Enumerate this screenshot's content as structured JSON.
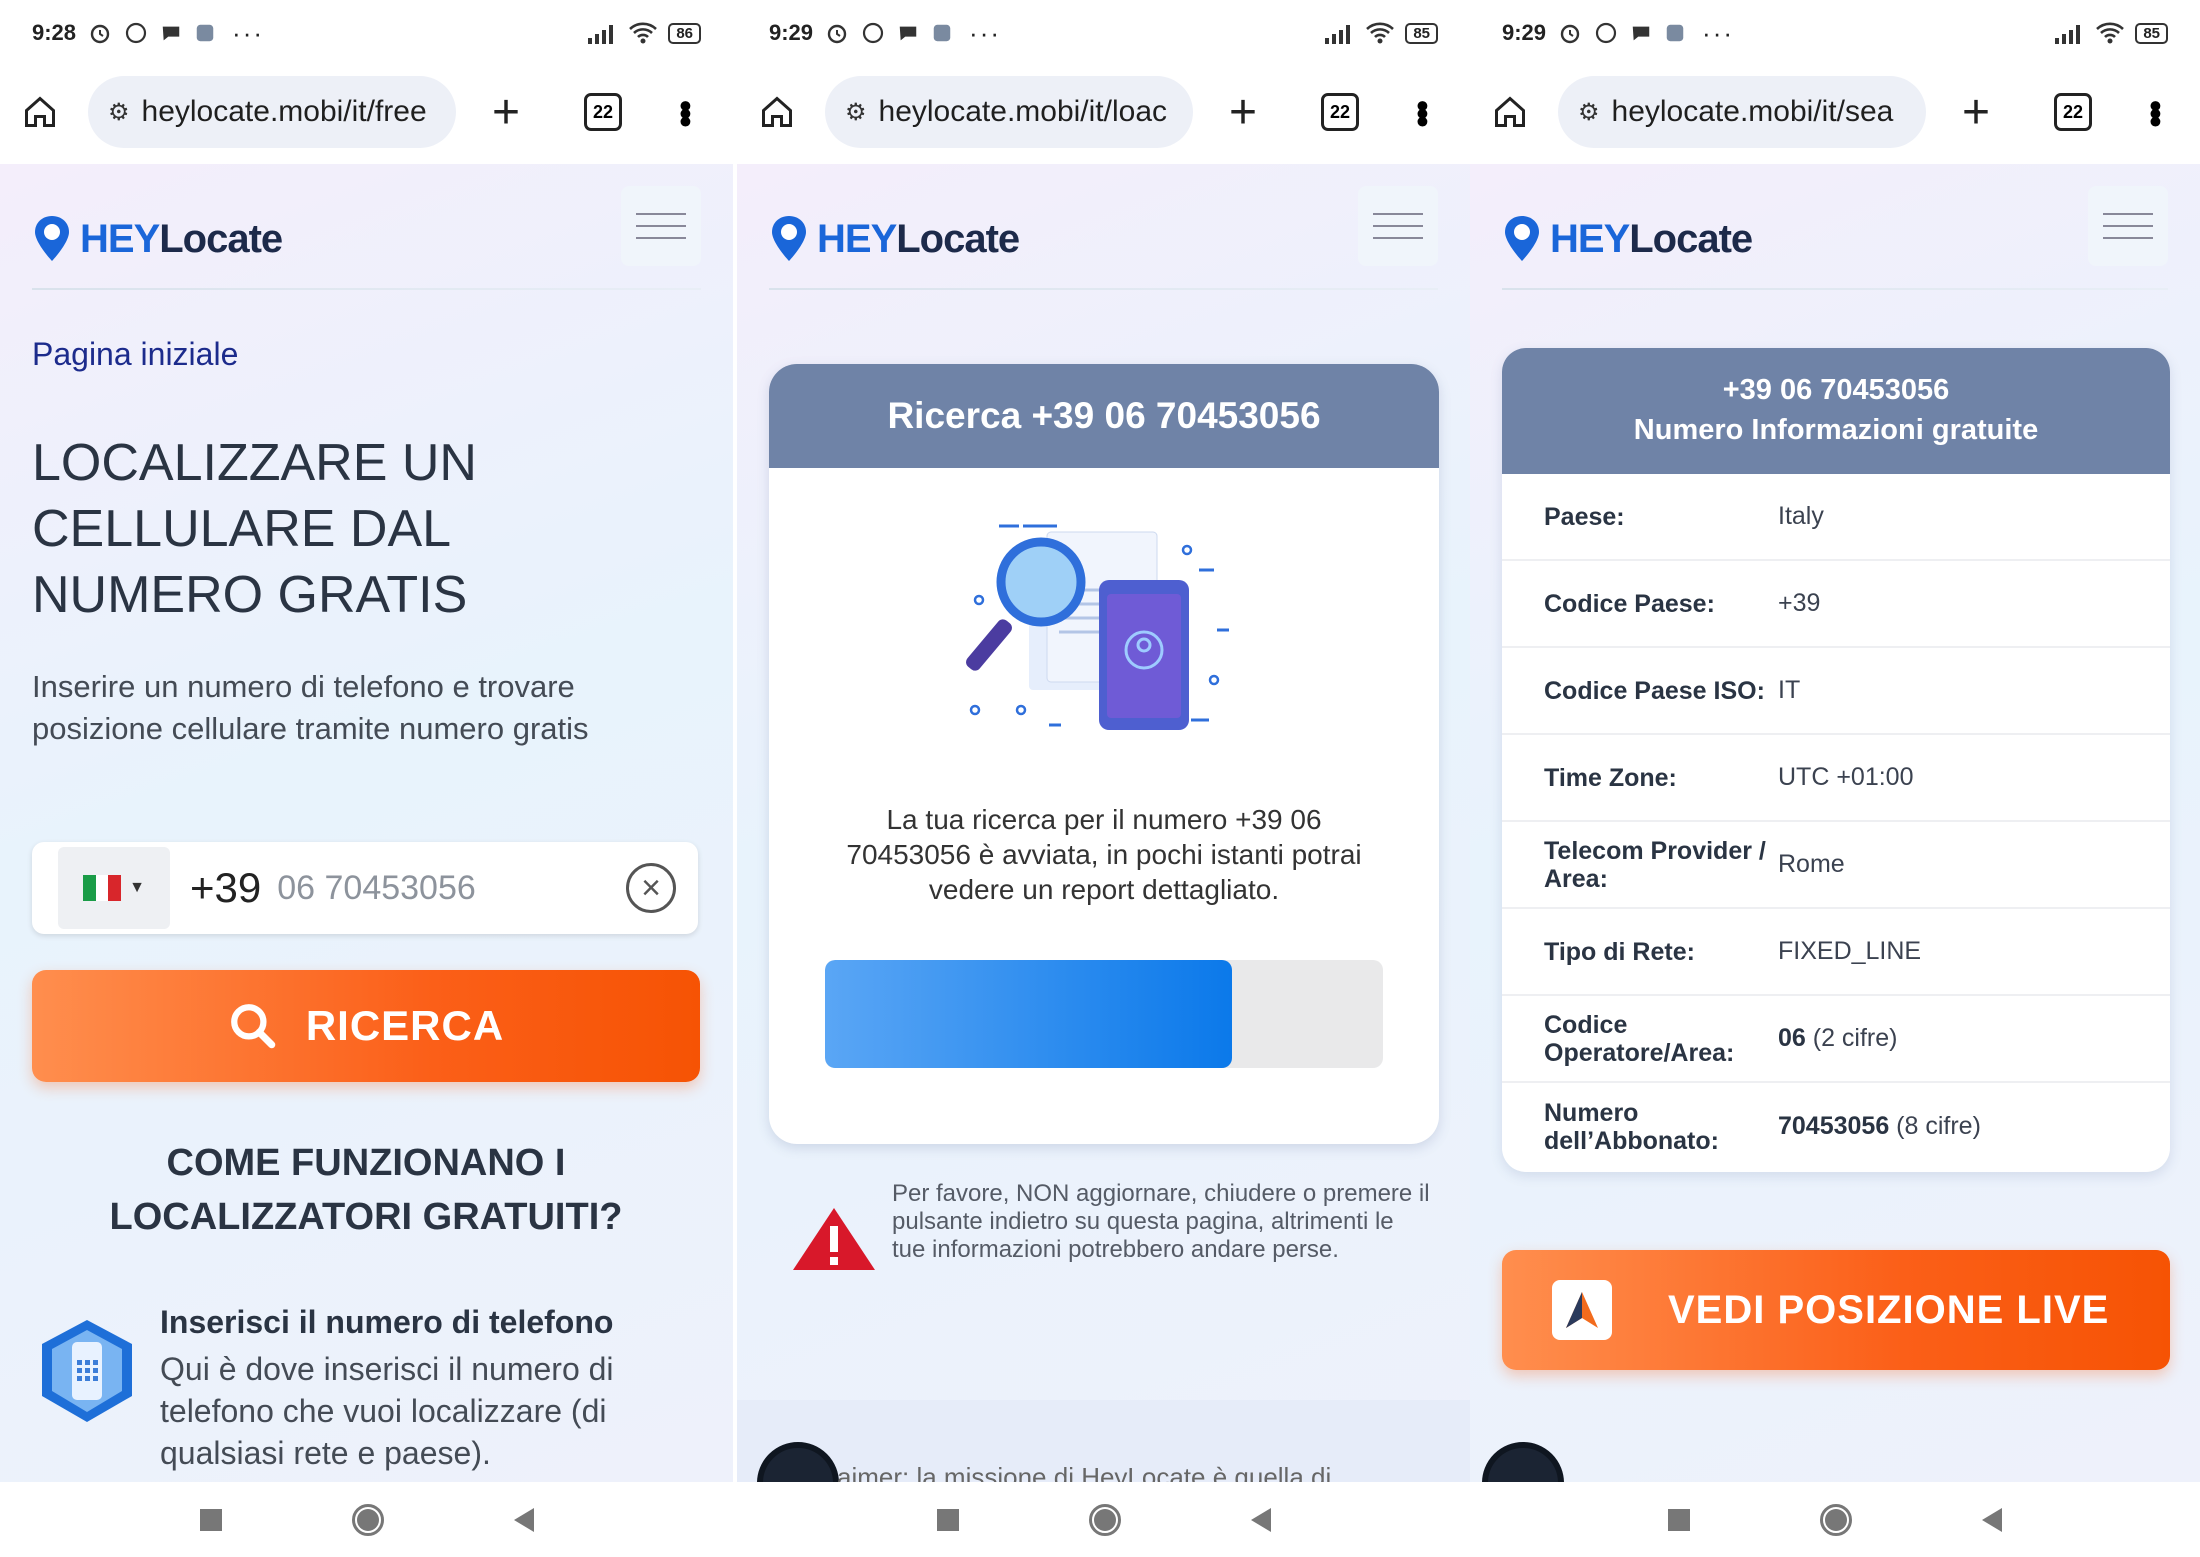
{
  "status_bars": [
    {
      "time": "9:28",
      "battery": "86"
    },
    {
      "time": "9:29",
      "battery": "85"
    },
    {
      "time": "9:29",
      "battery": "85"
    }
  ],
  "browser": {
    "tab_count": "22",
    "urls": [
      "heylocate.mobi/it/free",
      "heylocate.mobi/it/loac",
      "heylocate.mobi/it/sea"
    ]
  },
  "brand": {
    "hey": "HEY",
    "locate": "Locate"
  },
  "panel1": {
    "breadcrumb": "Pagina iniziale",
    "headline": "LOCALIZZARE UN CELLULARE DAL NUMERO GRATIS",
    "subtitle": "Inserire un numero di telefono e trovare posizione cellulare tramite numero gratis",
    "phone_prefix": "+39",
    "phone_value": "06 70453056",
    "search_label": "RICERCA",
    "how_heading": "COME FUNZIONANO I LOCALIZZATORI GRATUITI?",
    "step_title": "Inserisci il numero di telefono",
    "step_text": "Qui è dove inserisci il numero di telefono che vuoi localizzare (di qualsiasi rete e paese)."
  },
  "panel2": {
    "card_title": "Ricerca +39 06 70453056",
    "card_text": "La tua ricerca per il numero +39 06 70453056 è avviata, in pochi istanti potrai vedere un report dettagliato.",
    "progress_fraction": 0.73,
    "warning_text": "Per favore, NON aggiornare, chiudere o premere il pulsante indietro su questa pagina, altrimenti le tue informazioni potrebbero andare perse.",
    "footer_text": "aimer: la missione di HeyLocate è quella di"
  },
  "panel3": {
    "header_line1": "+39 06 70453056",
    "header_line2": "Numero Informazioni gratuite",
    "rows": [
      {
        "key": "Paese:",
        "value": "Italy",
        "extra": ""
      },
      {
        "key": "Codice Paese:",
        "value": "+39",
        "extra": ""
      },
      {
        "key": "Codice Paese ISO:",
        "value": "IT",
        "extra": ""
      },
      {
        "key": "Time Zone:",
        "value": "UTC +01:00",
        "extra": ""
      },
      {
        "key": "Telecom Provider / Area:",
        "value": "Rome",
        "extra": ""
      },
      {
        "key": "Tipo di Rete:",
        "value": "FIXED_LINE",
        "extra": ""
      },
      {
        "key": "Codice Operatore/Area:",
        "value": "06",
        "extra": " (2 cifre)"
      },
      {
        "key": "Numero dell’Abbonato:",
        "value": "70453056",
        "extra": " (8 cifre)"
      }
    ],
    "live_label": "VEDI POSIZIONE LIVE"
  },
  "colors": {
    "accent_orange": "#fb5f18",
    "header_slate": "#6f83a7",
    "brand_blue": "#1a66d9",
    "progress_blue": "#0b79ea"
  }
}
